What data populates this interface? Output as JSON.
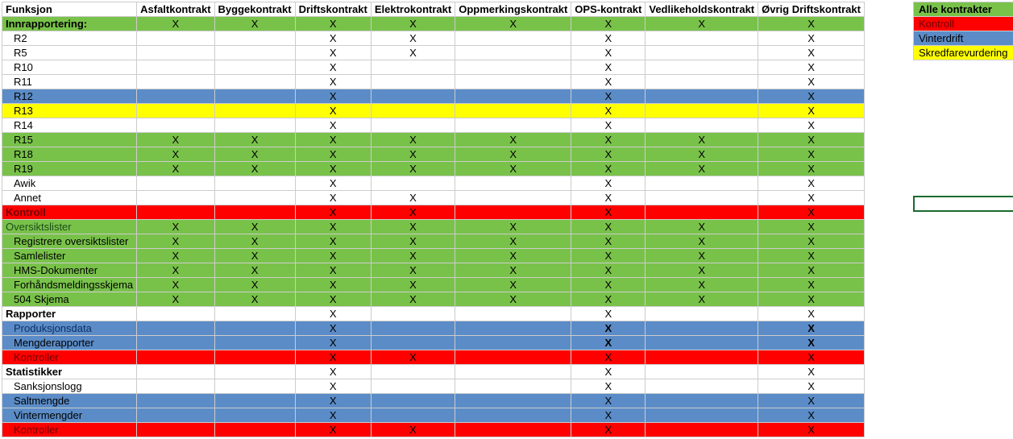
{
  "headers": [
    "Funksjon",
    "Asfaltkontrakt",
    "Byggekontrakt",
    "Driftskontrakt",
    "Elektrokontrakt",
    "Oppmerkingskontrakt",
    "OPS-kontrakt",
    "Vedlikeholdskontrakt",
    "Øvrig Driftskontrakt"
  ],
  "rows": [
    {
      "label": "Innrapportering:",
      "style": "row-green",
      "bold": true,
      "indent": 0,
      "marks": [
        "X",
        "X",
        "X",
        "X",
        "X",
        "X",
        "X",
        "X"
      ]
    },
    {
      "label": "R2",
      "style": "row-white",
      "indent": 1,
      "marks": [
        "",
        "",
        "X",
        "X",
        "",
        "X",
        "",
        "X"
      ]
    },
    {
      "label": "R5",
      "style": "row-white",
      "indent": 1,
      "marks": [
        "",
        "",
        "X",
        "X",
        "",
        "X",
        "",
        "X"
      ]
    },
    {
      "label": "R10",
      "style": "row-white",
      "indent": 1,
      "marks": [
        "",
        "",
        "X",
        "",
        "",
        "X",
        "",
        "X"
      ]
    },
    {
      "label": "R11",
      "style": "row-white",
      "indent": 1,
      "marks": [
        "",
        "",
        "X",
        "",
        "",
        "X",
        "",
        "X"
      ]
    },
    {
      "label": "R12",
      "style": "row-blue",
      "indent": 1,
      "marks": [
        "",
        "",
        "X",
        "",
        "",
        "X",
        "",
        "X"
      ]
    },
    {
      "label": "R13",
      "style": "row-yellow",
      "indent": 1,
      "marks": [
        "",
        "",
        "X",
        "",
        "",
        "X",
        "",
        "X"
      ]
    },
    {
      "label": "R14",
      "style": "row-white",
      "indent": 1,
      "marks": [
        "",
        "",
        "X",
        "",
        "",
        "X",
        "",
        "X"
      ]
    },
    {
      "label": "R15",
      "style": "row-green",
      "indent": 1,
      "marks": [
        "X",
        "X",
        "X",
        "X",
        "X",
        "X",
        "X",
        "X"
      ]
    },
    {
      "label": "R18",
      "style": "row-green",
      "indent": 1,
      "marks": [
        "X",
        "X",
        "X",
        "X",
        "X",
        "X",
        "X",
        "X"
      ]
    },
    {
      "label": "R19",
      "style": "row-green",
      "indent": 1,
      "marks": [
        "X",
        "X",
        "X",
        "X",
        "X",
        "X",
        "X",
        "X"
      ]
    },
    {
      "label": "Awik",
      "style": "row-white",
      "indent": 1,
      "marks": [
        "",
        "",
        "X",
        "",
        "",
        "X",
        "",
        "X"
      ]
    },
    {
      "label": "Annet",
      "style": "row-white",
      "indent": 1,
      "marks": [
        "",
        "",
        "X",
        "X",
        "",
        "X",
        "",
        "X"
      ]
    },
    {
      "label": "Kontroll",
      "style": "row-red",
      "bold": true,
      "textClass": "darkred",
      "indent": 0,
      "marks": [
        "",
        "",
        "X",
        "X",
        "",
        "X",
        "",
        "X"
      ]
    },
    {
      "label": "Oversiktslister",
      "style": "row-green",
      "textClass": "darkgreen",
      "indent": 0,
      "marks": [
        "X",
        "X",
        "X",
        "X",
        "X",
        "X",
        "X",
        "X"
      ]
    },
    {
      "label": "Registrere oversiktslister",
      "style": "row-green",
      "indent": 1,
      "marks": [
        "X",
        "X",
        "X",
        "X",
        "X",
        "X",
        "X",
        "X"
      ]
    },
    {
      "label": "Samlelister",
      "style": "row-green",
      "indent": 1,
      "marks": [
        "X",
        "X",
        "X",
        "X",
        "X",
        "X",
        "X",
        "X"
      ]
    },
    {
      "label": "HMS-Dokumenter",
      "style": "row-green",
      "indent": 1,
      "marks": [
        "X",
        "X",
        "X",
        "X",
        "X",
        "X",
        "X",
        "X"
      ]
    },
    {
      "label": "Forhåndsmeldingsskjema",
      "style": "row-green",
      "indent": 1,
      "marks": [
        "X",
        "X",
        "X",
        "X",
        "X",
        "X",
        "X",
        "X"
      ]
    },
    {
      "label": "504 Skjema",
      "style": "row-green",
      "indent": 1,
      "marks": [
        "X",
        "X",
        "X",
        "X",
        "X",
        "X",
        "X",
        "X"
      ]
    },
    {
      "label": "Rapporter",
      "style": "row-white",
      "bold": true,
      "indent": 0,
      "marks": [
        "",
        "",
        "X",
        "",
        "",
        "X",
        "",
        "X"
      ]
    },
    {
      "label": "Produksjonsdata",
      "style": "row-blue",
      "textClass": "darkblue",
      "indent": 1,
      "marks": [
        "",
        "",
        "X",
        "",
        "",
        "X",
        "",
        "X"
      ],
      "boldMarks": [
        5,
        7
      ]
    },
    {
      "label": "Mengderapporter",
      "style": "row-blue",
      "indent": 1,
      "marks": [
        "",
        "",
        "X",
        "",
        "",
        "X",
        "",
        "X"
      ],
      "boldMarks": [
        5,
        7
      ]
    },
    {
      "label": "Kontroller",
      "style": "row-red",
      "textClass": "darkred",
      "indent": 1,
      "marks": [
        "",
        "",
        "X",
        "X",
        "",
        "X",
        "",
        "X"
      ]
    },
    {
      "label": "Statistikker",
      "style": "row-white",
      "bold": true,
      "indent": 0,
      "marks": [
        "",
        "",
        "X",
        "",
        "",
        "X",
        "",
        "X"
      ]
    },
    {
      "label": "Sanksjonslogg",
      "style": "row-white",
      "indent": 1,
      "marks": [
        "",
        "",
        "X",
        "",
        "",
        "X",
        "",
        "X"
      ]
    },
    {
      "label": "Saltmengde",
      "style": "row-blue",
      "indent": 1,
      "marks": [
        "",
        "",
        "X",
        "",
        "",
        "X",
        "",
        "X"
      ]
    },
    {
      "label": "Vintermengder",
      "style": "row-blue",
      "indent": 1,
      "marks": [
        "",
        "",
        "X",
        "",
        "",
        "X",
        "",
        "X"
      ]
    },
    {
      "label": "Kontroller",
      "style": "row-red",
      "textClass": "darkred",
      "indent": 1,
      "marks": [
        "",
        "",
        "X",
        "X",
        "",
        "X",
        "",
        "X"
      ]
    }
  ],
  "legend": [
    {
      "label": "Alle kontrakter",
      "cls": "lg-green"
    },
    {
      "label": "Kontroll",
      "cls": "lg-red"
    },
    {
      "label": "Vinterdrift",
      "cls": "lg-blue"
    },
    {
      "label": "Skredfarevurdering",
      "cls": "lg-yellow"
    }
  ]
}
